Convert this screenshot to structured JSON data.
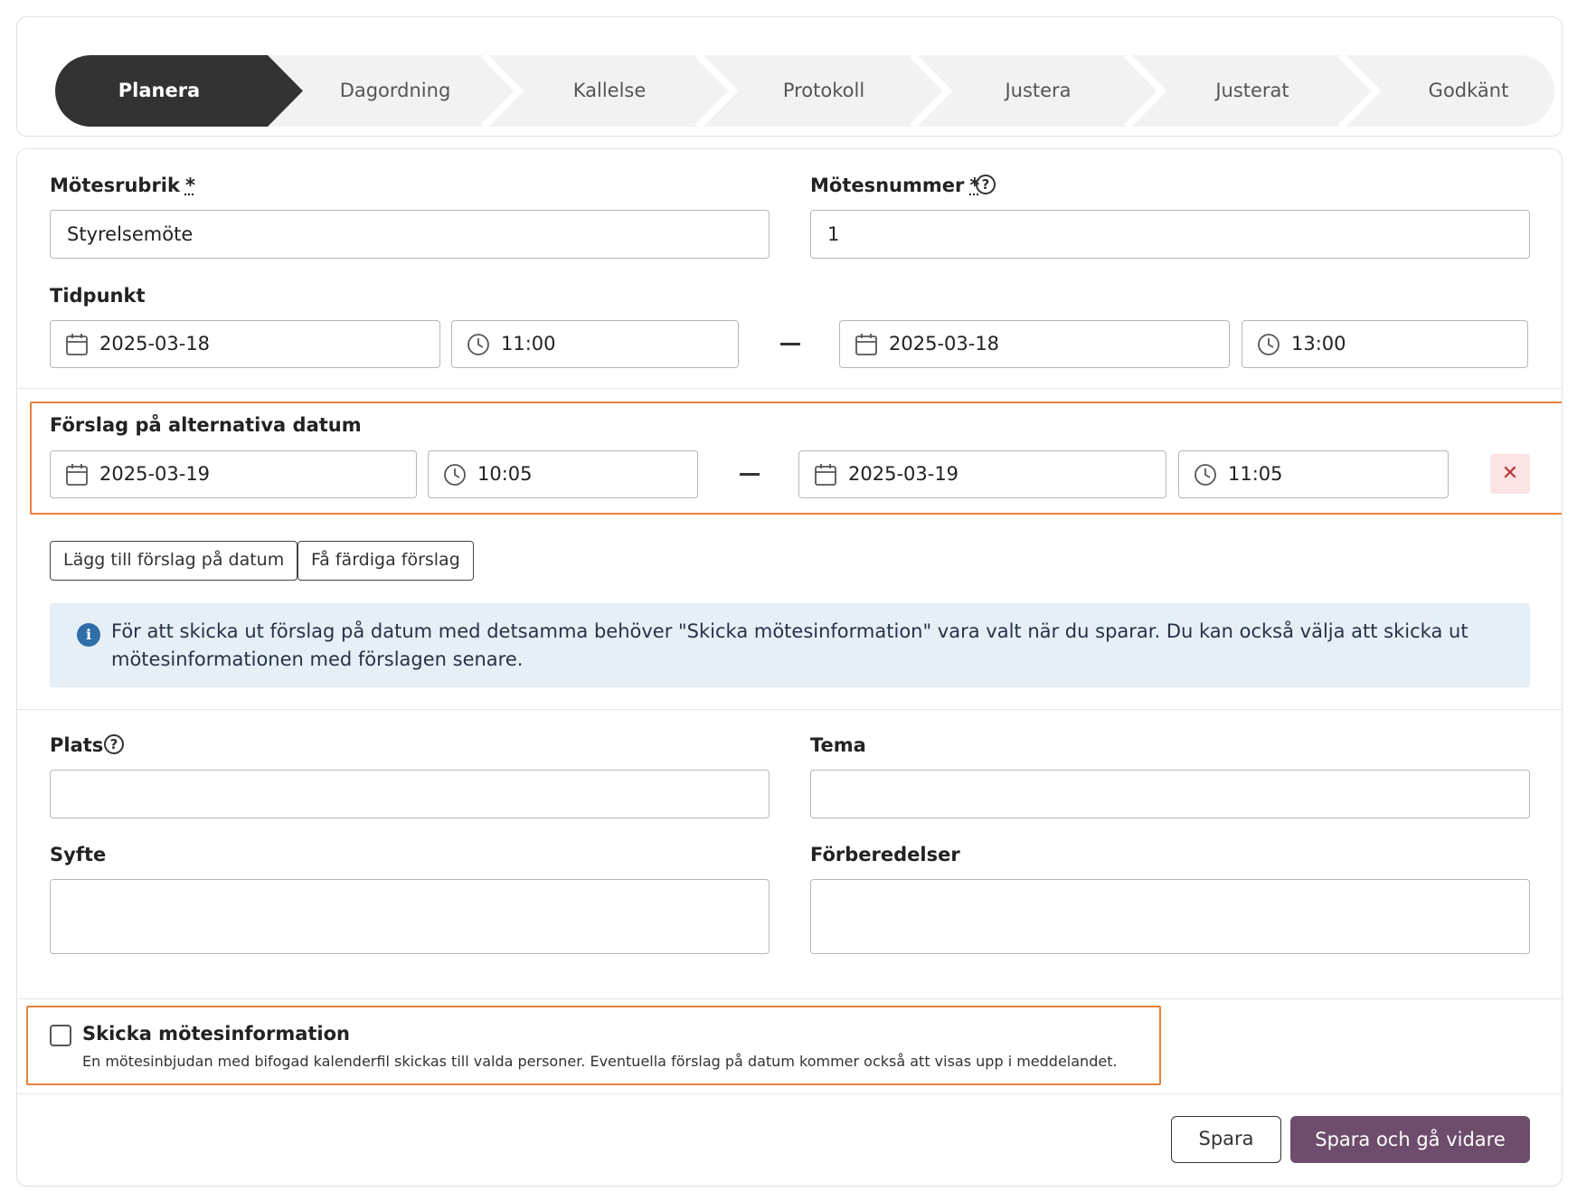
{
  "stepper": {
    "steps": [
      "Planera",
      "Dagordning",
      "Kallelse",
      "Protokoll",
      "Justera",
      "Justerat",
      "Godkänt"
    ],
    "active_index": 0
  },
  "form": {
    "title_label": "Mötesrubrik",
    "title_value": "Styrelsemöte",
    "number_label": "Mötesnummer",
    "number_value": "1",
    "required_mark": "*",
    "time_label": "Tidpunkt",
    "start_date": "2025-03-18",
    "start_time": "11:00",
    "end_date": "2025-03-18",
    "end_time": "13:00",
    "alt_label": "Förslag på alternativa datum",
    "alt_start_date": "2025-03-19",
    "alt_start_time": "10:05",
    "alt_end_date": "2025-03-19",
    "alt_end_time": "11:05",
    "remove_icon": "✕",
    "add_suggestion_button": "Lägg till förslag på datum",
    "ready_suggestions_button": "Få färdiga förslag",
    "info_icon": "i",
    "info_text": "För att skicka ut förslag på datum med detsamma behöver \"Skicka mötesinformation\" vara valt när du sparar. Du kan också välja att skicka ut mötesinformationen med förslagen senare.",
    "place_label": "Plats",
    "theme_label": "Tema",
    "purpose_label": "Syfte",
    "preparations_label": "Förberedelser",
    "help_glyph": "?",
    "send_label": "Skicka mötesinformation",
    "send_desc": "En mötesinbjudan med bifogad kalenderfil skickas till valda personer. Eventuella förslag på datum kommer också att visas upp i meddelandet.",
    "save_button": "Spara",
    "save_continue_button": "Spara och gå vidare"
  },
  "colors": {
    "active_step": "#333333",
    "inactive_step": "#f2f2f2",
    "highlight_border": "#e8823b",
    "primary_button": "#6d4d6b",
    "info_bg": "#e6eef6",
    "remove_bg": "#fbe3e3"
  }
}
